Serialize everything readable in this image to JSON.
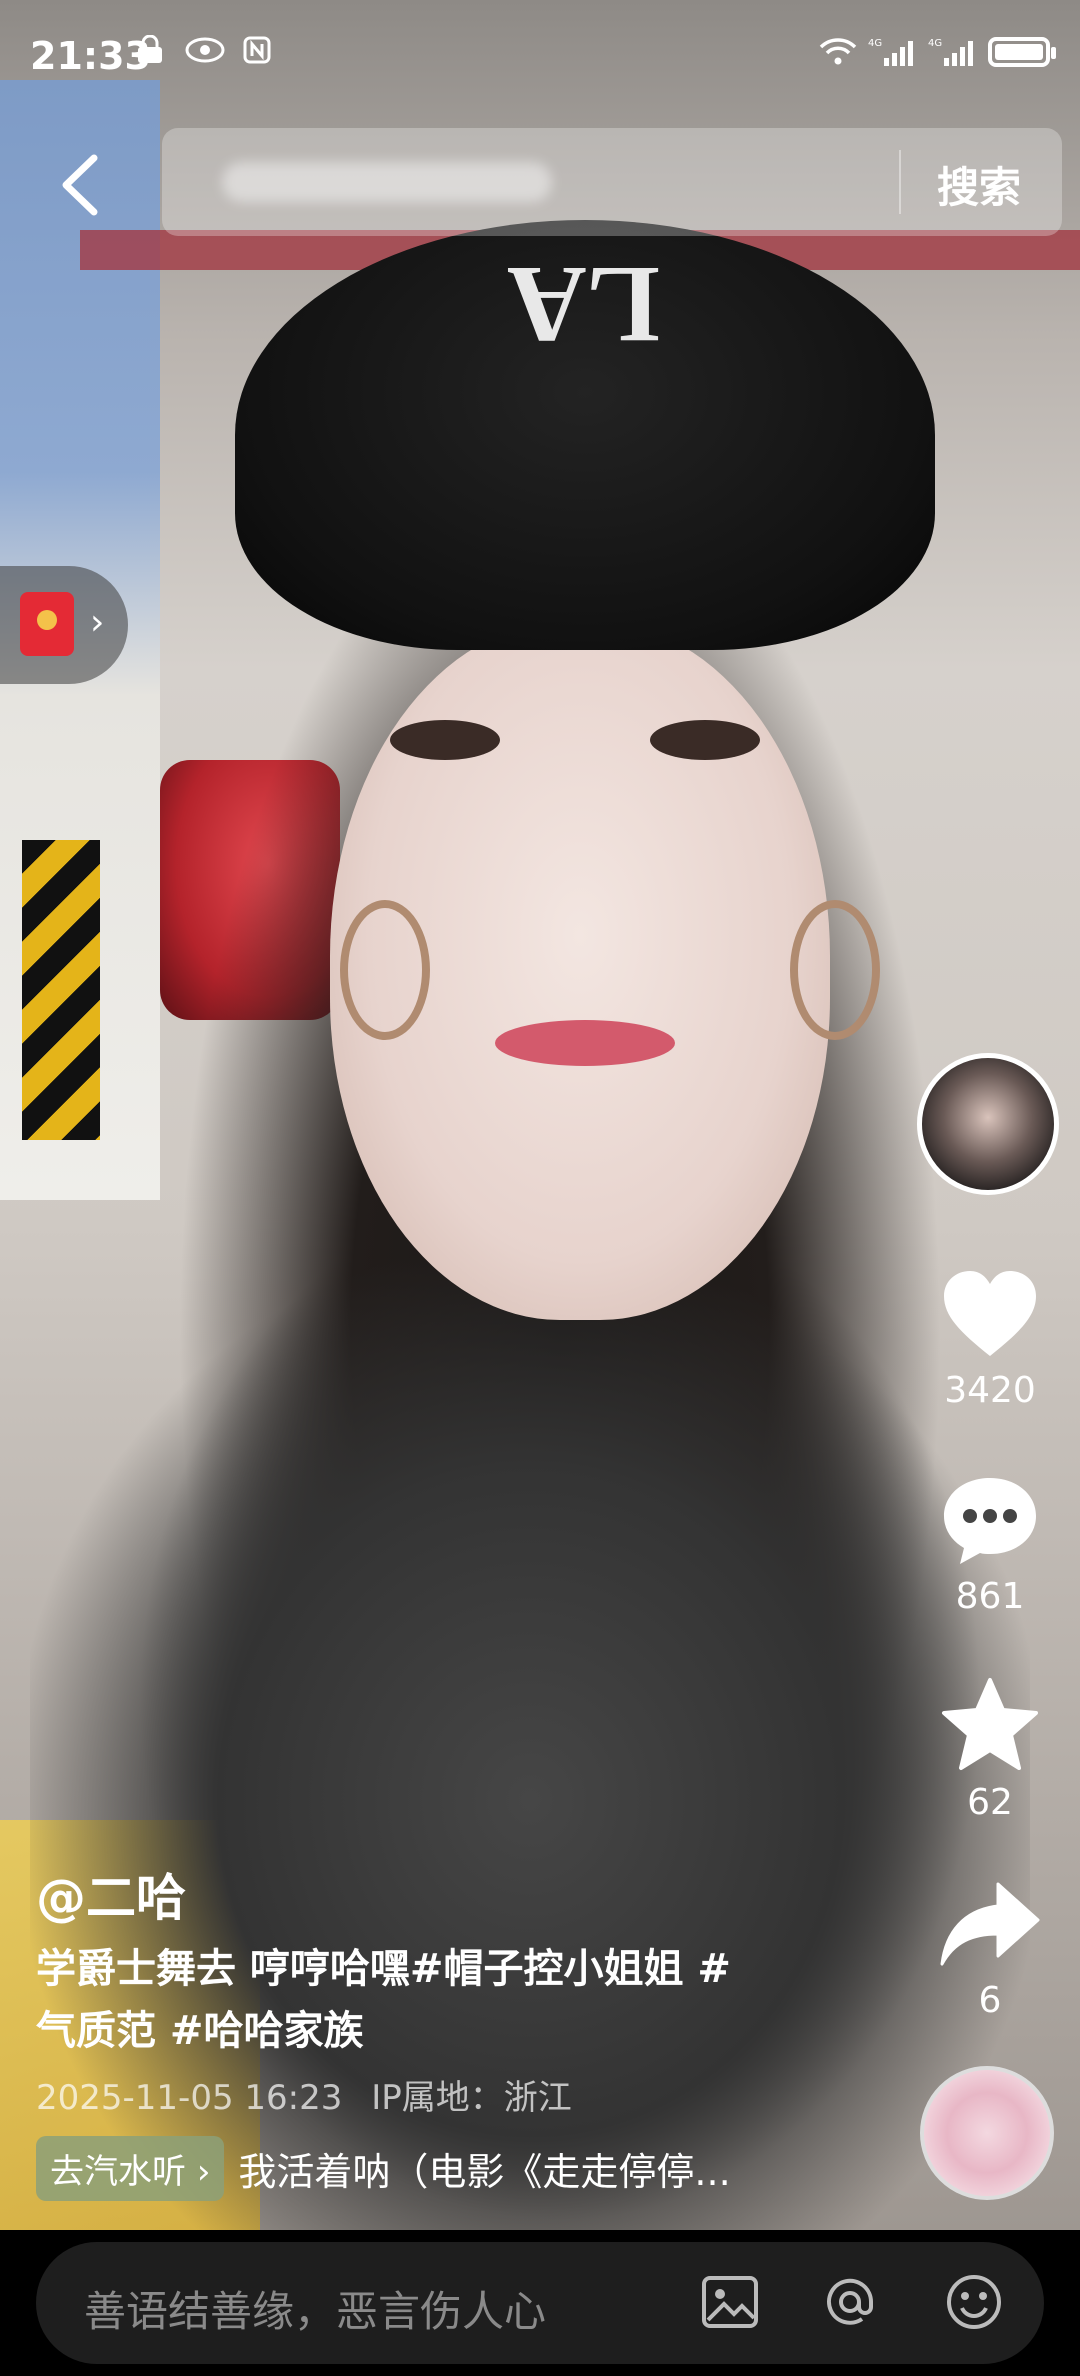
{
  "status_bar": {
    "time": "21:33"
  },
  "search": {
    "button_label": "搜索"
  },
  "right_rail": {
    "likes": "3420",
    "comments": "861",
    "favorites": "62",
    "shares": "6"
  },
  "caption": {
    "author": "@二哈",
    "description_line1": "学爵士舞去 哼哼哈嘿#帽子控小姐姐 #",
    "description_line2": "气质范 #哈哈家族",
    "timestamp": "2025-11-05 16:23",
    "ip_location": "IP属地：浙江",
    "music_chip": "去汽水听",
    "music_title": "我活着呐（电影《走走停停..."
  },
  "comment_input": {
    "placeholder": "善语结善缘，恶言伤人心"
  },
  "icons": {
    "back": "chevron-left-icon",
    "like": "heart-icon",
    "comment": "comment-bubble-icon",
    "favorite": "star-icon",
    "share": "share-arrow-icon",
    "image": "image-icon",
    "mention": "at-icon",
    "emoji": "emoji-icon"
  },
  "colors": {
    "like_fill": "#ffffff",
    "red_packet": "#e42a35"
  }
}
